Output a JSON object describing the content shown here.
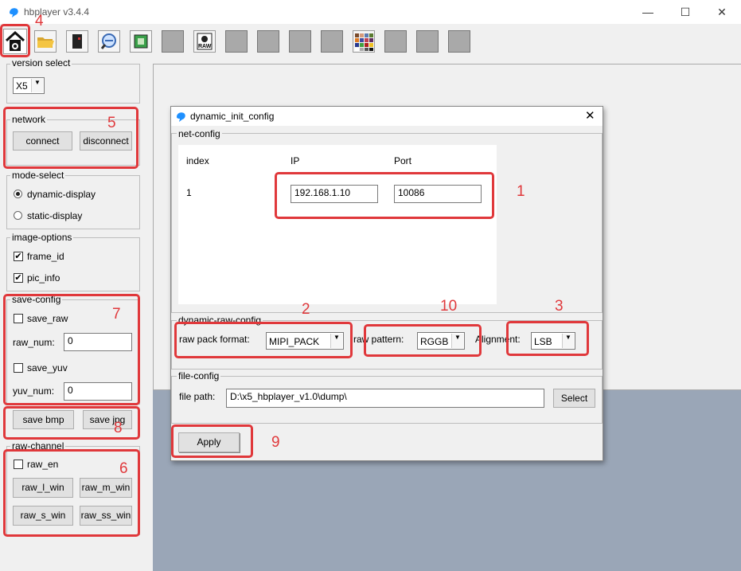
{
  "app": {
    "title": "hbplayer v3.4.4",
    "min_icon": "minimize-icon",
    "max_icon": "maximize-icon",
    "close_icon": "close-icon"
  },
  "sidebar": {
    "version_select": {
      "label": "version select",
      "value": "X5"
    },
    "network": {
      "label": "network",
      "connect": "connect",
      "disconnect": "disconnect"
    },
    "mode_select": {
      "label": "mode-select",
      "options": [
        "dynamic-display",
        "static-display"
      ],
      "selected": "dynamic-display"
    },
    "image_options": {
      "label": "image-options",
      "items": [
        {
          "label": "frame_id",
          "checked": true
        },
        {
          "label": "pic_info",
          "checked": true
        }
      ]
    },
    "save_config": {
      "label": "save-config",
      "save_raw": "save_raw",
      "raw_num_label": "raw_num:",
      "raw_num": "0",
      "save_yuv": "save_yuv",
      "yuv_num_label": "yuv_num:",
      "yuv_num": "0"
    },
    "save_buttons": {
      "bmp": "save bmp",
      "jpg": "save jpg"
    },
    "raw_channel": {
      "label": "raw-channel",
      "raw_en": "raw_en",
      "buttons": [
        "raw_l_win",
        "raw_m_win",
        "raw_s_win",
        "raw_ss_win"
      ]
    }
  },
  "dialog": {
    "title": "dynamic_init_config",
    "net_config": {
      "label": "net-config",
      "headers": [
        "index",
        "IP",
        "Port"
      ],
      "rows": [
        {
          "index": "1",
          "ip": "192.168.1.10",
          "port": "10086"
        }
      ]
    },
    "raw_config": {
      "label": "dynamic-raw-config",
      "pack_label": "raw pack format:",
      "pack_value": "MIPI_PACK",
      "pattern_label": "raw pattern:",
      "pattern_value": "RGGB",
      "align_label": "Alignment:",
      "align_value": "LSB"
    },
    "file_config": {
      "label": "file-config",
      "path_label": "file path:",
      "path_value": "D:\\x5_hbplayer_v1.0\\dump\\",
      "select": "Select"
    },
    "apply": "Apply"
  },
  "annotations": [
    "1",
    "2",
    "3",
    "4",
    "5",
    "6",
    "7",
    "8",
    "9",
    "10"
  ],
  "colors": {
    "annotation": "#e0383b",
    "workspace": "#9aa6b7",
    "accent": "#1e90ff"
  }
}
